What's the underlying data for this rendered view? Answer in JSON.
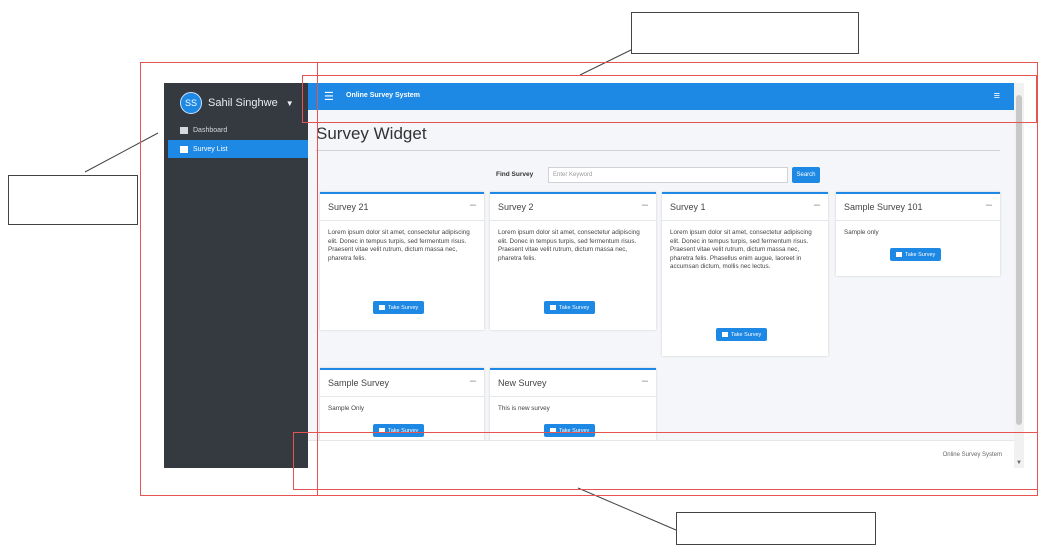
{
  "sidebar": {
    "avatar_initials": "SS",
    "user_name": "Sahil Singhwe",
    "items": [
      {
        "label": "Dashboard",
        "icon": "dashboard-icon"
      },
      {
        "label": "Survey List",
        "icon": "list-icon"
      }
    ]
  },
  "topbar": {
    "app_name": "Online Survey System",
    "menu_icon": "hamburger-icon",
    "right_icon": "menu-icon"
  },
  "page": {
    "title": "Survey Widget",
    "find_label": "Find Survey",
    "search_placeholder": "Enter Keyword",
    "search_button": "Search"
  },
  "cards": [
    {
      "title": "Survey 21",
      "body": "Lorem ipsum dolor sit amet, consectetur adipiscing elit. Donec in tempus turpis, sed fermentum risus. Praesent vitae velit rutrum, dictum massa nec, pharetra felis.",
      "button": "Take Survey"
    },
    {
      "title": "Survey 2",
      "body": "Lorem ipsum dolor sit amet, consectetur adipiscing elit. Donec in tempus turpis, sed fermentum risus. Praesent vitae velit rutrum, dictum massa nec, pharetra felis.",
      "button": "Take Survey"
    },
    {
      "title": "Survey 1",
      "body": "Lorem ipsum dolor sit amet, consectetur adipiscing elit. Donec in tempus turpis, sed fermentum risus. Praesent vitae velit rutrum, dictum massa nec, pharetra felis. Phasellus enim augue, laoreet in accumsan dictum, mollis nec lectus.",
      "button": "Take Survey"
    },
    {
      "title": "Sample Survey 101",
      "body": "Sample only",
      "button": "Take Survey"
    },
    {
      "title": "Sample Survey",
      "body": "Sample Only",
      "button": "Take Survey"
    },
    {
      "title": "New Survey",
      "body": "This is new survey",
      "button": "Take Survey"
    }
  ],
  "footer": {
    "text": "Online Survey System"
  },
  "colors": {
    "primary": "#1e88e5",
    "sidebar": "#343a40",
    "annotation": "#e55353"
  }
}
